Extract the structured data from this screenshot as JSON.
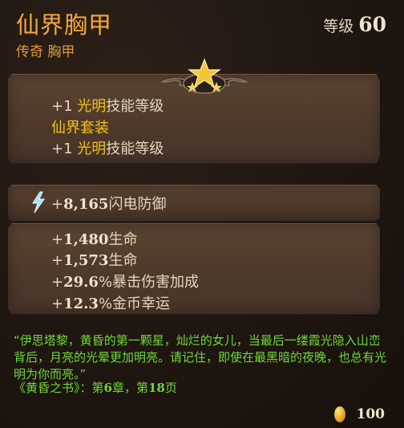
{
  "item": {
    "name": "仙界胸甲",
    "rarity_type": "传奇 胸甲",
    "level_label": "等级",
    "level_value": "60"
  },
  "skills": [
    {
      "prefix": "+1 ",
      "highlight": "光明",
      "suffix": "技能等级"
    },
    {
      "set_name": "仙界套装"
    },
    {
      "prefix": "+1 ",
      "highlight": "光明",
      "suffix": "技能等级"
    }
  ],
  "main_stat": {
    "prefix": "+",
    "value": "8,165",
    "label": "闪电防御",
    "icon": "lightning-icon"
  },
  "stats": [
    {
      "prefix": "+",
      "value": "1,480",
      "label": "生命"
    },
    {
      "prefix": "+",
      "value": "1,573",
      "label": "生命"
    },
    {
      "prefix": "+",
      "value": "29.6",
      "label": "%暴击伤害加成"
    },
    {
      "prefix": "+",
      "value": "12.3",
      "label": "%金币幸运"
    }
  ],
  "lore": {
    "quote": "“伊思塔黎，黄昏的第一颗星，灿烂的女儿，当最后一缕霞光隐入山峦背后，月亮的光晕更加明亮。请记住，即使在最黑暗的夜晚，也总有光明为你而亮。”",
    "source_title": "《黄昏之书》：第",
    "chapter": "6",
    "chapter_suffix": "章，第",
    "page": "18",
    "page_suffix": "页"
  },
  "price": {
    "value": "100",
    "icon": "gold-coin-icon"
  },
  "colors": {
    "title": "#f2a83a",
    "highlight": "#f2c21a",
    "lore": "#6fd83a",
    "panel": "#4f3a2b"
  }
}
